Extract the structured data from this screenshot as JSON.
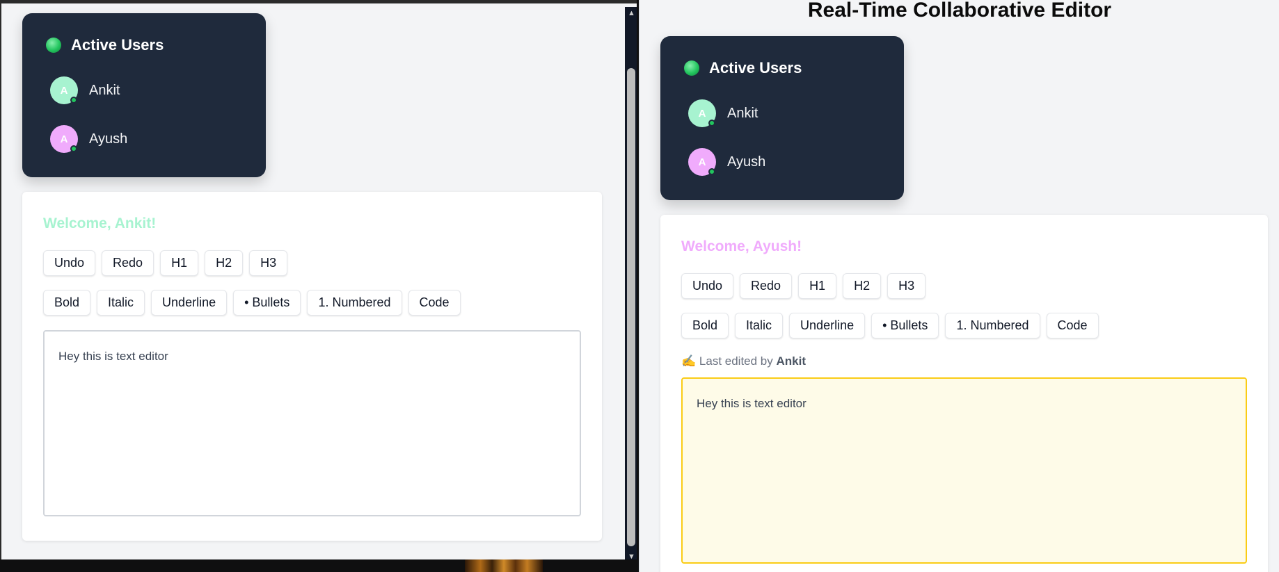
{
  "app_title": "Real-Time Collaborative Editor",
  "colors": {
    "panel_bg": "#1f2a3c",
    "online_green": "#22c55e",
    "ankit_color": "#a7f3d0",
    "ayush_color": "#f0abfc",
    "highlight_border": "#facc15",
    "highlight_bg": "#fefbe8"
  },
  "left_pane": {
    "users_title": "Active Users",
    "users": [
      {
        "initial": "A",
        "name": "Ankit"
      },
      {
        "initial": "A",
        "name": "Ayush"
      }
    ],
    "welcome": "Welcome, Ankit!",
    "toolbar_row1": [
      "Undo",
      "Redo",
      "H1",
      "H2",
      "H3"
    ],
    "toolbar_row2": [
      "Bold",
      "Italic",
      "Underline",
      "• Bullets",
      "1. Numbered",
      "Code"
    ],
    "content": "Hey this is text editor"
  },
  "right_pane": {
    "users_title": "Active Users",
    "users": [
      {
        "initial": "A",
        "name": "Ankit"
      },
      {
        "initial": "A",
        "name": "Ayush"
      }
    ],
    "welcome": "Welcome, Ayush!",
    "toolbar_row1": [
      "Undo",
      "Redo",
      "H1",
      "H2",
      "H3"
    ],
    "toolbar_row2": [
      "Bold",
      "Italic",
      "Underline",
      "• Bullets",
      "1. Numbered",
      "Code"
    ],
    "last_edited_icon": "✍️",
    "last_edited_prefix": "Last edited by",
    "last_edited_user": "Ankit",
    "content": "Hey this is text editor"
  }
}
